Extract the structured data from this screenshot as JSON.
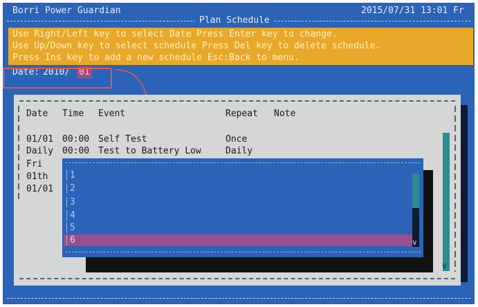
{
  "header": {
    "app_title": "Borri Power Guardian",
    "datetime": "2015/07/31 13:01 Fr",
    "section_title": "Plan Schedule"
  },
  "help": {
    "lines": [
      "Use Right/Left key to select Date Press Enter key to change.",
      "Use Up/Down key to select schedule Press Del key to delete schedule.",
      "Press Ins key to add a new schedule Esc:Back to menu."
    ]
  },
  "date": {
    "label": "Date:",
    "year": "2010/",
    "month": "01"
  },
  "table": {
    "columns": [
      "Date",
      "Time",
      "Event",
      "Repeat",
      "Note"
    ],
    "rows": [
      {
        "date": "01/01",
        "time": "00:00",
        "event": "Self Test",
        "repeat": "Once",
        "note": ""
      },
      {
        "date": "Daily",
        "time": "00:00",
        "event": "Test to Battery Low",
        "repeat": "Daily",
        "note": ""
      },
      {
        "date": "Fri",
        "time": "",
        "event": "",
        "repeat": "",
        "note": ""
      },
      {
        "date": "01th",
        "time": "",
        "event": "",
        "repeat": "",
        "note": ""
      },
      {
        "date": "01/01",
        "time": "",
        "event": "",
        "repeat": "",
        "note": ""
      }
    ],
    "scroll_down_glyph": "v"
  },
  "popup": {
    "options": [
      "1",
      "2",
      "3",
      "4",
      "5",
      "6"
    ],
    "selected_index": 5,
    "scroll_down_glyph": "v"
  },
  "colors": {
    "screen_bg": "#2a63b8",
    "help_bg": "#e8a92a",
    "panel_bg": "#d5d6d6",
    "selection": "#9b4e8e",
    "scrollbar": "#2d8b93",
    "annotation": "#e05a4e"
  }
}
